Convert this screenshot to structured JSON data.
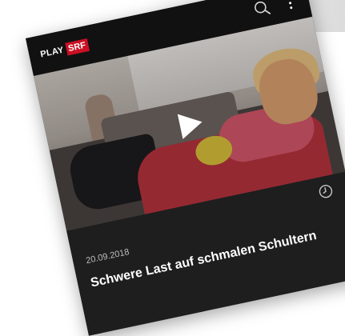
{
  "app": {
    "logo_play": "PLAY",
    "logo_srf": "SRF",
    "brand_color": "#c91024"
  },
  "toolbar": {
    "search_icon": "search-icon",
    "more_icon": "more-vertical-icon"
  },
  "video": {
    "play_icon": "play-icon",
    "duration_icon": "clock-icon"
  },
  "episode": {
    "date": "20.09.2018",
    "title": "Schwere Last auf schmalen Schultern"
  }
}
